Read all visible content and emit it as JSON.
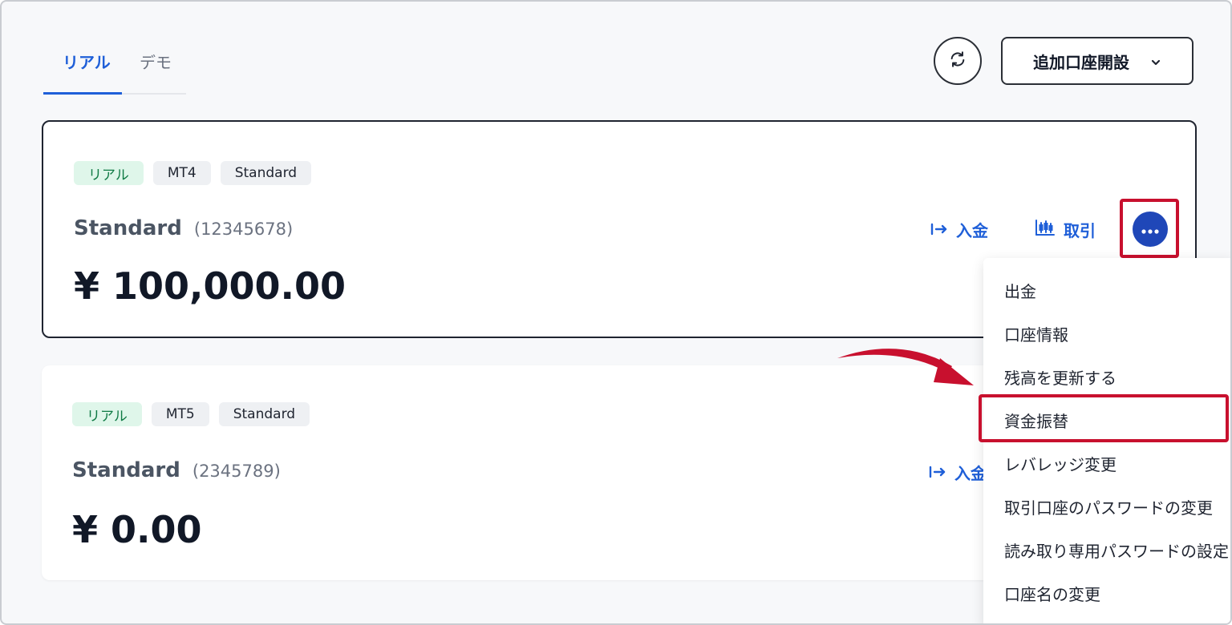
{
  "tabs": [
    {
      "label": "リアル",
      "active": true
    },
    {
      "label": "デモ",
      "active": false
    }
  ],
  "header": {
    "refresh_icon": "refresh-icon",
    "add_account_label": "追加口座開設",
    "add_account_icon": "chevron-down-icon"
  },
  "accounts": [
    {
      "badges": [
        "リアル",
        "MT4",
        "Standard"
      ],
      "name": "Standard",
      "number": "(12345678)",
      "balance": "¥ 100,000.00",
      "deposit_label": "入金",
      "trade_label": "取引"
    },
    {
      "badges": [
        "リアル",
        "MT5",
        "Standard"
      ],
      "name": "Standard",
      "number": "(2345789)",
      "balance": "¥ 0.00",
      "deposit_label": "入金"
    }
  ],
  "menu": {
    "items": [
      "出金",
      "口座情報",
      "残高を更新する",
      "資金振替",
      "レバレッジ変更",
      "取引口座のパスワードの変更",
      "読み取り専用パスワードの設定",
      "口座名の変更"
    ],
    "highlighted_index": 3
  },
  "colors": {
    "accent": "#1f5fd8",
    "more_button": "#1f47b8",
    "highlight_red": "#c8102e",
    "real_badge_bg": "#dff6ea",
    "real_badge_text": "#0f7a44"
  }
}
